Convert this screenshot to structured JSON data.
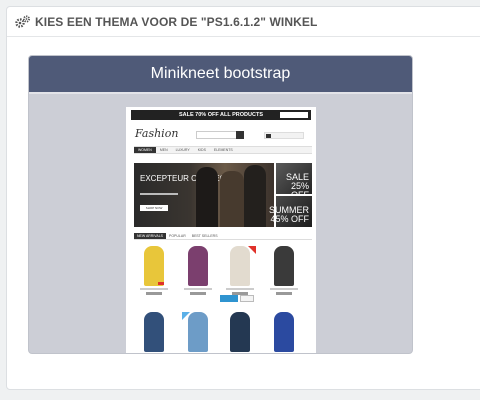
{
  "panel": {
    "title": "KIES EEN THEMA VOOR DE \"PS1.6.1.2\" WINKEL",
    "icon": "cogs-icon"
  },
  "theme_card": {
    "name": "Minikneet bootstrap",
    "header_color": "#4f5a78"
  },
  "preview": {
    "promo_bar": "SALE 70% OFF ALL PRODUCTS",
    "logo": "Fashion",
    "nav_items": [
      "WOMEN",
      "MEN",
      "LUXURY",
      "KIDS",
      "ELEMENTS"
    ],
    "hero_text": "EXCEPTEUR OCCAECAT",
    "hero_button": "SHOP NOW",
    "promo1_text": "SALE 25% OFF",
    "promo2_text": "SUMMER 45% OFF",
    "tabs": [
      "NEW ARRIVALS",
      "POPULAR",
      "BEST SELLERS"
    ]
  }
}
